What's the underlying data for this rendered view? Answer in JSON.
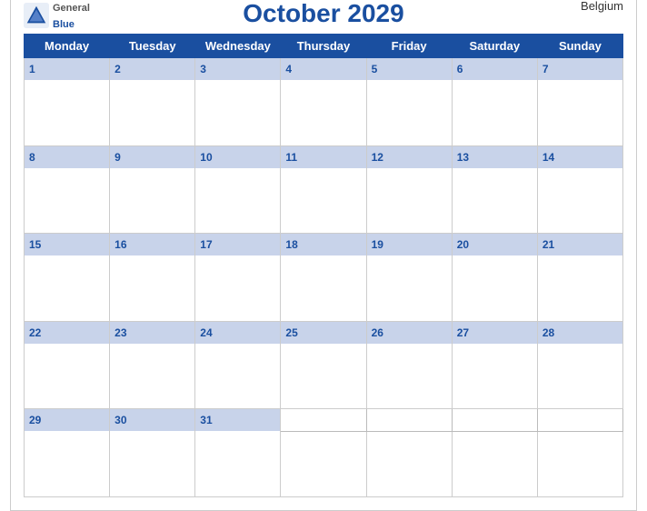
{
  "header": {
    "logo": {
      "general": "General",
      "blue": "Blue",
      "icon": "triangle"
    },
    "title": "October 2029",
    "country": "Belgium"
  },
  "weekdays": [
    "Monday",
    "Tuesday",
    "Wednesday",
    "Thursday",
    "Friday",
    "Saturday",
    "Sunday"
  ],
  "weeks": [
    {
      "dates": [
        1,
        2,
        3,
        4,
        5,
        6,
        7
      ]
    },
    {
      "dates": [
        8,
        9,
        10,
        11,
        12,
        13,
        14
      ]
    },
    {
      "dates": [
        15,
        16,
        17,
        18,
        19,
        20,
        21
      ]
    },
    {
      "dates": [
        22,
        23,
        24,
        25,
        26,
        27,
        28
      ]
    },
    {
      "dates": [
        29,
        30,
        31,
        null,
        null,
        null,
        null
      ]
    }
  ],
  "colors": {
    "header_bg": "#1a4fa0",
    "date_row_bg": "#c8d3ea",
    "body_bg": "#ffffff",
    "border": "#aab5cc"
  }
}
